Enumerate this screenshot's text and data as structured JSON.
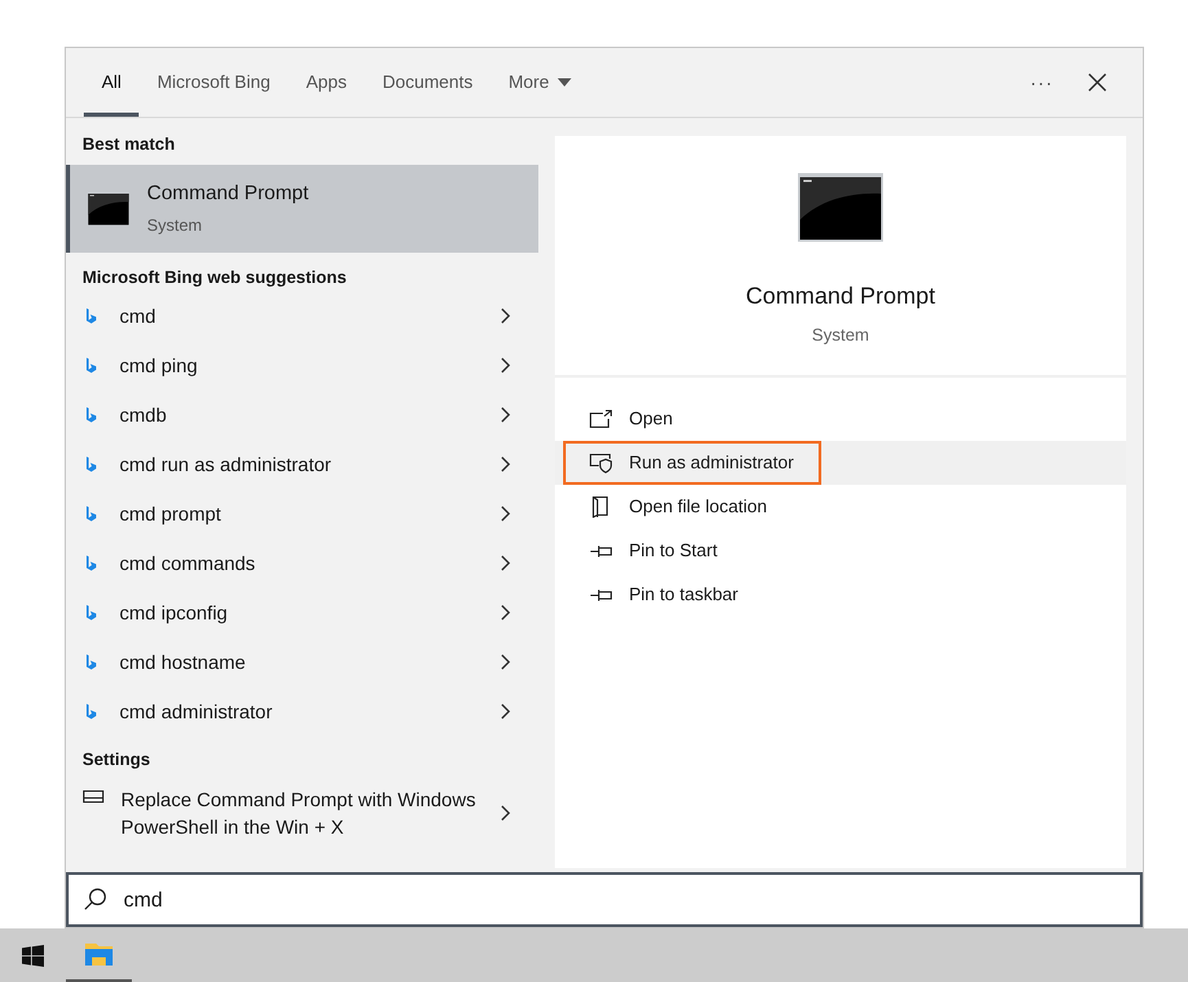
{
  "tabs": [
    {
      "label": "All",
      "selected": true
    },
    {
      "label": "Microsoft Bing",
      "selected": false
    },
    {
      "label": "Apps",
      "selected": false
    },
    {
      "label": "Documents",
      "selected": false
    },
    {
      "label": "More",
      "selected": false,
      "kind": "dropdown"
    }
  ],
  "more_options": "···",
  "best_match": {
    "heading": "Best match",
    "title": "Command Prompt",
    "subtitle": "System",
    "selected": true
  },
  "web_suggestions": {
    "heading": "Microsoft Bing web suggestions",
    "items": [
      "cmd",
      "cmd ping",
      "cmdb",
      "cmd run as administrator",
      "cmd prompt",
      "cmd commands",
      "cmd ipconfig",
      "cmd hostname",
      "cmd administrator"
    ]
  },
  "settings": {
    "heading": "Settings",
    "items": [
      {
        "label": "Replace Command Prompt with Windows PowerShell in the Win + X"
      }
    ]
  },
  "detail": {
    "title": "Command Prompt",
    "subtitle": "System",
    "actions": [
      {
        "label": "Open",
        "kind": "open",
        "highlighted": false
      },
      {
        "label": "Run as administrator",
        "kind": "admin",
        "highlighted": true
      },
      {
        "label": "Open file location",
        "kind": "location",
        "highlighted": false
      },
      {
        "label": "Pin to Start",
        "kind": "pin",
        "highlighted": false
      },
      {
        "label": "Pin to taskbar",
        "kind": "pin",
        "highlighted": false
      }
    ]
  },
  "search": {
    "value": "cmd"
  }
}
